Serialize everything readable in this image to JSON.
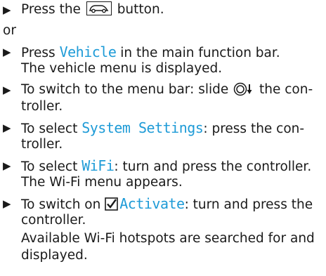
{
  "steps": [
    {
      "before": "Press the ",
      "after": " button.",
      "icon": "car-button-icon"
    },
    {
      "or": "or"
    },
    {
      "line1_before": "Press ",
      "keyword": "Vehicle",
      "line1_after": " in the main function bar.",
      "line2": "The vehicle menu is displayed."
    },
    {
      "line1_before": "To switch to the menu bar: slide ",
      "line1_after": " the con-",
      "line2": "troller.",
      "icon": "controller-slide-down-icon"
    },
    {
      "line1_before": "To select ",
      "keyword": "System Settings",
      "line1_after": ": press the con-",
      "line2": "troller."
    },
    {
      "line1_before": "To select ",
      "keyword": "WiFi",
      "line1_after": ": turn and press the controller.",
      "line2": "The Wi-Fi menu appears."
    },
    {
      "line1_before": "To switch on ",
      "keyword": "Activate",
      "line1_after": ": turn and press the",
      "line2": "controller.",
      "line3": "Available Wi-Fi hotspots are searched for and",
      "line4": "displayed.",
      "icon": "checkbox-checked-icon"
    }
  ],
  "colors": {
    "keyword": "#1e9bd7",
    "text": "#1a1a1a"
  }
}
